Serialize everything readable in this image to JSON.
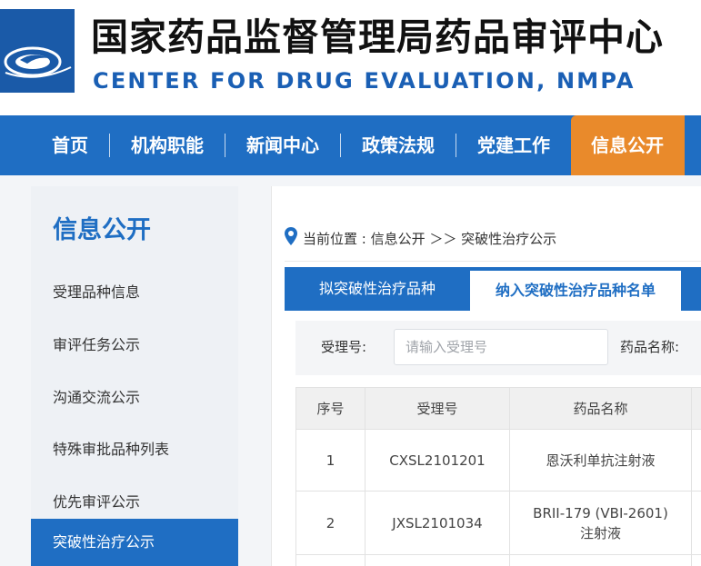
{
  "header": {
    "title_cn": "国家药品监督管理局药品审评中心",
    "title_en": "CENTER FOR DRUG EVALUATION, NMPA"
  },
  "nav": {
    "items": [
      "首页",
      "机构职能",
      "新闻中心",
      "政策法规",
      "党建工作",
      "信息公开"
    ]
  },
  "sidebar": {
    "title": "信息公开",
    "items": [
      "受理品种信息",
      "审评任务公示",
      "沟通交流公示",
      "特殊审批品种列表",
      "优先审评公示",
      "突破性治疗公示"
    ]
  },
  "breadcrumb": {
    "text": "当前位置 : 信息公开 ＞＞ 突破性治疗公示"
  },
  "tabs": {
    "tab1": "拟突破性治疗品种",
    "tab2": "纳入突破性治疗品种名单"
  },
  "search": {
    "label_accept_no": "受理号:",
    "placeholder": "请输入受理号",
    "label_drug_name": "药品名称:"
  },
  "table": {
    "headers": [
      "序号",
      "受理号",
      "药品名称"
    ],
    "rows": [
      {
        "no": "1",
        "accept_no": "CXSL2101201",
        "drug": "恩沃利单抗注射液"
      },
      {
        "no": "2",
        "accept_no": "JXSL2101034",
        "drug": "BRII-179 (VBI-2601)\n注射液"
      }
    ]
  },
  "colors": {
    "primary": "#1f6ec3",
    "accent": "#e98a2b"
  }
}
